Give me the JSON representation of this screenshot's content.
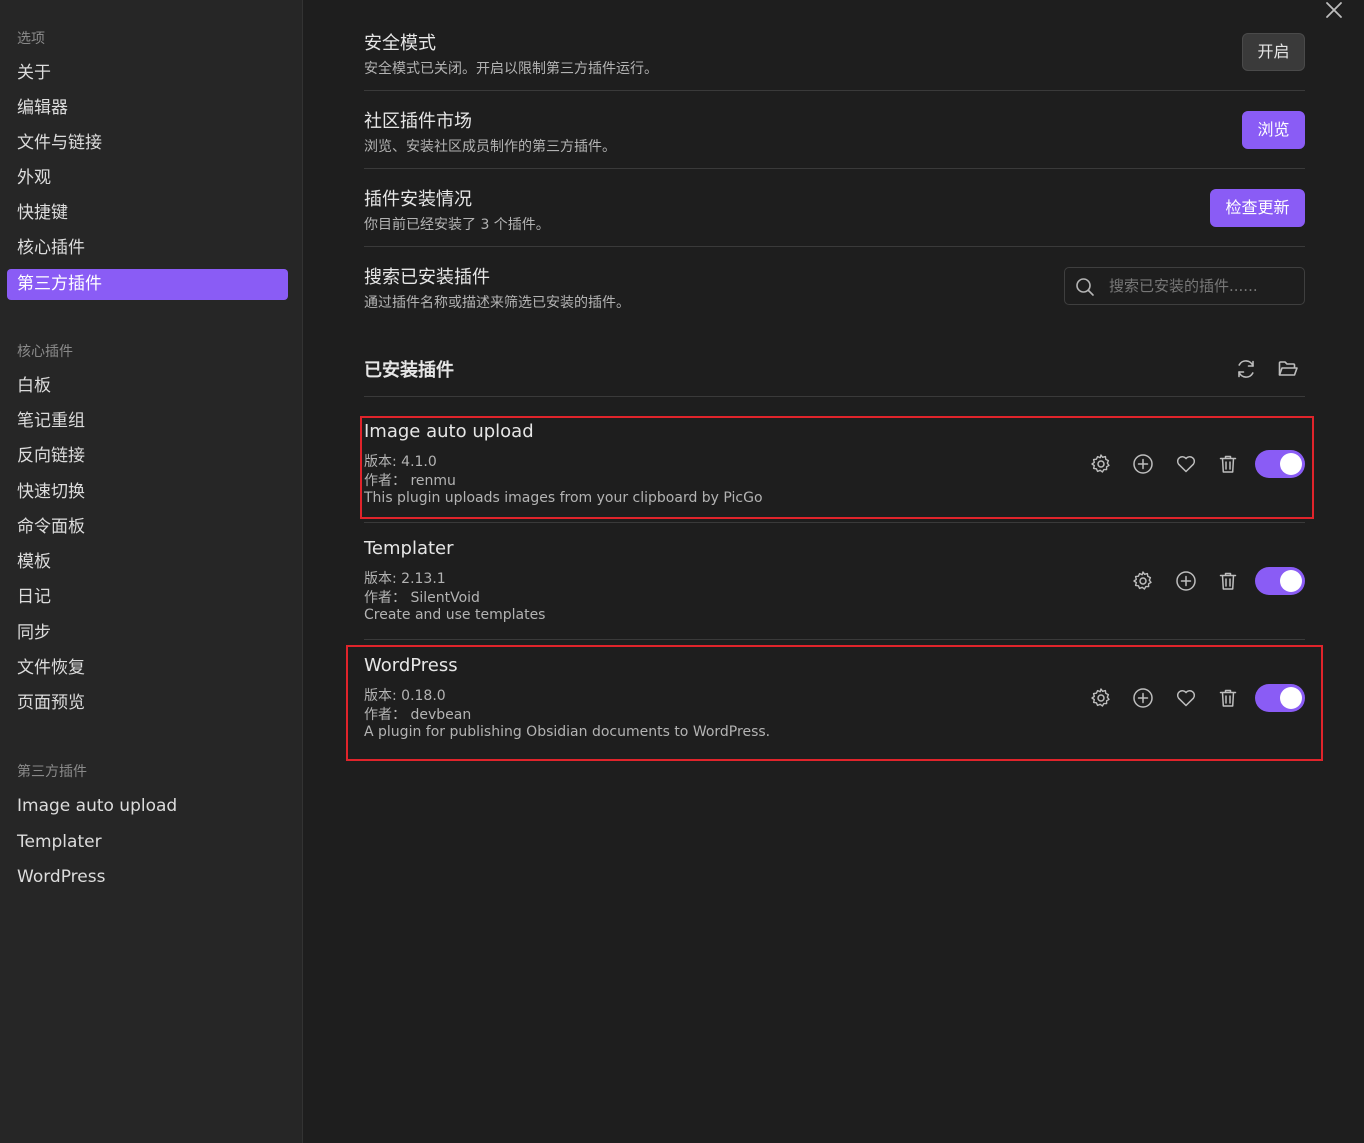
{
  "sidebar": {
    "options_heading": "选项",
    "options": [
      {
        "label": "关于"
      },
      {
        "label": "编辑器"
      },
      {
        "label": "文件与链接"
      },
      {
        "label": "外观"
      },
      {
        "label": "快捷键"
      },
      {
        "label": "核心插件"
      },
      {
        "label": "第三方插件",
        "active": true
      }
    ],
    "core_heading": "核心插件",
    "core_plugins": [
      {
        "label": "白板"
      },
      {
        "label": "笔记重组"
      },
      {
        "label": "反向链接"
      },
      {
        "label": "快速切换"
      },
      {
        "label": "命令面板"
      },
      {
        "label": "模板"
      },
      {
        "label": "日记"
      },
      {
        "label": "同步"
      },
      {
        "label": "文件恢复"
      },
      {
        "label": "页面预览"
      }
    ],
    "third_heading": "第三方插件",
    "third_plugins": [
      {
        "label": "Image auto upload"
      },
      {
        "label": "Templater"
      },
      {
        "label": "WordPress"
      }
    ]
  },
  "settings": {
    "safe_mode": {
      "title": "安全模式",
      "desc": "安全模式已关闭。开启以限制第三方插件运行。",
      "button": "开启"
    },
    "community": {
      "title": "社区插件市场",
      "desc": "浏览、安装社区成员制作的第三方插件。",
      "button": "浏览"
    },
    "installed_status": {
      "title": "插件安装情况",
      "desc": "你目前已经安装了 3 个插件。",
      "button": "检查更新"
    },
    "search": {
      "title": "搜索已安装插件",
      "desc": "通过插件名称或描述来筛选已安装的插件。",
      "placeholder": "搜索已安装的插件......"
    }
  },
  "installed": {
    "title": "已安装插件",
    "plugins": [
      {
        "name": "Image auto upload",
        "version": "版本: 4.1.0",
        "author": "作者：  renmu",
        "desc": "This plugin uploads images from your clipboard by PicGo",
        "enabled": true,
        "highlighted": true
      },
      {
        "name": "Templater",
        "version": "版本: 2.13.1",
        "author": "作者：  SilentVoid",
        "desc": "Create and use templates",
        "enabled": true,
        "highlighted": false
      },
      {
        "name": "WordPress",
        "version": "版本: 0.18.0",
        "author": "作者：  devbean",
        "desc": "A plugin for publishing Obsidian documents to WordPress.",
        "enabled": true,
        "highlighted": true
      }
    ]
  },
  "colors": {
    "accent": "#8a5cf5",
    "highlight": "#e0242b",
    "background": "#1e1e1e",
    "sidebar": "#262626"
  },
  "icons": [
    "close-icon",
    "search-icon",
    "reload-icon",
    "folder-open-icon",
    "gear-icon",
    "plus-circle-icon",
    "heart-icon",
    "trash-icon"
  ]
}
